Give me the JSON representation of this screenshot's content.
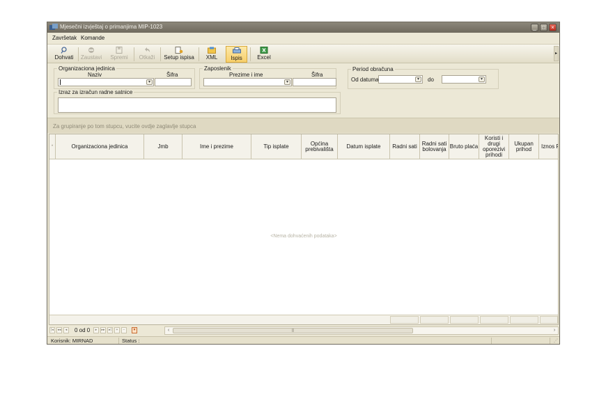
{
  "window": {
    "title": "Mjesečni izvještaj o primanjima  MIP-1023"
  },
  "menu": [
    "Završetak",
    "Komande"
  ],
  "toolbar": {
    "buttons": [
      {
        "label": "Dohvati",
        "icon": "magnifier-icon",
        "enabled": true
      },
      {
        "label": "Zaustavi",
        "icon": "stop-icon",
        "enabled": false
      },
      {
        "label": "Spremi",
        "icon": "save-icon",
        "enabled": false
      },
      {
        "label": "Otkaži",
        "icon": "undo-icon",
        "enabled": false
      },
      {
        "label": "Setup ispisa",
        "icon": "page-setup-icon",
        "enabled": true
      },
      {
        "label": "XML",
        "icon": "xml-icon",
        "enabled": true
      },
      {
        "label": "Ispis",
        "icon": "printer-icon",
        "enabled": true,
        "active": true
      },
      {
        "label": "Excel",
        "icon": "excel-icon",
        "enabled": true
      }
    ]
  },
  "filters": {
    "org_unit": {
      "title": "Organizaciona jedinica",
      "name_label": "Naziv",
      "code_label": "Šifra",
      "name_value": "",
      "code_value": ""
    },
    "employee": {
      "title": "Zaposlenik",
      "name_label": "Prezime i ime",
      "code_label": "Šifra",
      "name_value": "",
      "code_value": ""
    },
    "period": {
      "title": "Period obračuna",
      "from_label": "Od datuma",
      "to_label": "do",
      "from_value": "",
      "to_value": ""
    },
    "formula": {
      "title": "Izraz za izračun radne satnice",
      "value": ""
    }
  },
  "grid": {
    "group_panel_text": "Za grupiranje po tom stupcu, vucite ovdje zaglavlje stupca",
    "columns": [
      "Organizaciona jedinica",
      "Jmb",
      "Ime i prezime",
      "Tip isplate",
      "Općina\nprebivališta",
      "Datum isplate",
      "Radni sati",
      "Radni sati\nbolovanja",
      "Bruto plaća",
      "Koristi i\ndrugi\noporezivi\nprihodi",
      "Ukupan\nprihod",
      "Iznos P"
    ],
    "empty_text": "<Nema dohvaćenih podataka>",
    "pager": {
      "text": "0 od 0"
    }
  },
  "status": {
    "user": "Korisnik: MIRNAD",
    "status": "Status :"
  },
  "colors": {
    "title_bar": "#6f6a5e",
    "background": "#ece8d6",
    "active_button": "#f7cf6b",
    "close_button": "#b8291b"
  }
}
